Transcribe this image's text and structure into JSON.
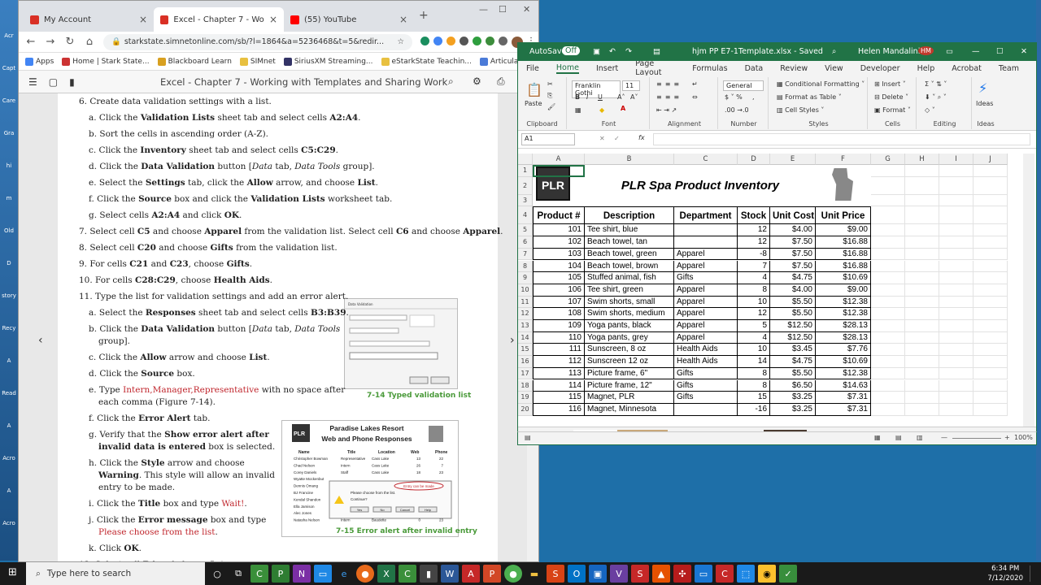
{
  "desktop": {
    "icons": [
      "Acr",
      "Capt",
      "Care",
      "Gra",
      "hi",
      "m",
      "Old",
      "D",
      "story",
      "Recy",
      "A",
      "Read",
      "A",
      "Acro",
      "A",
      "Acro"
    ]
  },
  "browser": {
    "tabs": [
      {
        "label": "My Account",
        "color": "#d93025"
      },
      {
        "label": "Excel - Chapter 7 - Working with",
        "color": "#d93025"
      },
      {
        "label": "(55) YouTube",
        "color": "#ff0000"
      }
    ],
    "url": "starkstate.simnetonline.com/sb/?l=1864&a=5236468&t=5&redir...",
    "bookmarks": [
      "Apps",
      "Home | Stark State...",
      "Blackboard Learn",
      "SIMnet",
      "SiriusXM Streaming...",
      "eStarkState Teachin...",
      "Articulate E-Learnin..."
    ],
    "reader_title": "Excel - Chapter 7 - Working with Templates and Sharing Work"
  },
  "instructions": [
    {
      "parts": [
        [
          "n",
          "6. Create data validation settings with a list."
        ]
      ]
    },
    {
      "parts": [
        [
          "n",
          "a. Click the "
        ],
        [
          "b",
          "Validation Lists"
        ],
        [
          "n",
          " sheet tab and select cells "
        ],
        [
          "b",
          "A2:A4"
        ],
        [
          "n",
          "."
        ]
      ]
    },
    {
      "parts": [
        [
          "n",
          "b. Sort the cells in ascending order (A-Z)."
        ]
      ]
    },
    {
      "parts": [
        [
          "n",
          "c. Click the "
        ],
        [
          "b",
          "Inventory"
        ],
        [
          "n",
          " sheet tab and select cells "
        ],
        [
          "b",
          "C5:C29"
        ],
        [
          "n",
          "."
        ]
      ]
    },
    {
      "parts": [
        [
          "n",
          "d. Click the "
        ],
        [
          "b",
          "Data Validation"
        ],
        [
          "n",
          " button ["
        ],
        [
          "i",
          "Data"
        ],
        [
          "n",
          " tab, "
        ],
        [
          "i",
          "Data Tools"
        ],
        [
          "n",
          " group]."
        ]
      ]
    },
    {
      "parts": [
        [
          "n",
          "e. Select the "
        ],
        [
          "b",
          "Settings"
        ],
        [
          "n",
          " tab, click the "
        ],
        [
          "b",
          "Allow"
        ],
        [
          "n",
          " arrow, and choose "
        ],
        [
          "b",
          "List"
        ],
        [
          "n",
          "."
        ]
      ]
    },
    {
      "parts": [
        [
          "n",
          "f. Click the "
        ],
        [
          "b",
          "Source"
        ],
        [
          "n",
          " box and click the "
        ],
        [
          "b",
          "Validation Lists"
        ],
        [
          "n",
          " worksheet tab."
        ]
      ]
    },
    {
      "parts": [
        [
          "n",
          "g. Select cells "
        ],
        [
          "b",
          "A2:A4"
        ],
        [
          "n",
          " and click "
        ],
        [
          "b",
          "OK"
        ],
        [
          "n",
          "."
        ]
      ]
    },
    {
      "parts": [
        [
          "n",
          "7. Select cell "
        ],
        [
          "b",
          "C5"
        ],
        [
          "n",
          " and choose "
        ],
        [
          "b",
          "Apparel"
        ],
        [
          "n",
          " from the validation list. Select cell "
        ],
        [
          "b",
          "C6"
        ],
        [
          "n",
          " and choose "
        ],
        [
          "b",
          "Apparel"
        ],
        [
          "n",
          "."
        ]
      ]
    },
    {
      "parts": [
        [
          "n",
          "8. Select cell "
        ],
        [
          "b",
          "C20"
        ],
        [
          "n",
          " and choose "
        ],
        [
          "b",
          "Gifts"
        ],
        [
          "n",
          " from the validation list."
        ]
      ]
    },
    {
      "parts": [
        [
          "n",
          "9. For cells "
        ],
        [
          "b",
          "C21"
        ],
        [
          "n",
          " and "
        ],
        [
          "b",
          "C23"
        ],
        [
          "n",
          ", choose "
        ],
        [
          "b",
          "Gifts"
        ],
        [
          "n",
          "."
        ]
      ]
    },
    {
      "parts": [
        [
          "n",
          "10. For cells "
        ],
        [
          "b",
          "C28:C29"
        ],
        [
          "n",
          ", choose "
        ],
        [
          "b",
          "Health Aids"
        ],
        [
          "n",
          "."
        ]
      ]
    },
    {
      "parts": [
        [
          "n",
          "11. Type the list for validation settings and add an error alert."
        ]
      ]
    },
    {
      "parts": [
        [
          "n",
          "a. Select the "
        ],
        [
          "b",
          "Responses"
        ],
        [
          "n",
          " sheet tab and select cells "
        ],
        [
          "b",
          "B3:B39"
        ],
        [
          "n",
          "."
        ]
      ]
    },
    {
      "parts": [
        [
          "n",
          "b. Click the "
        ],
        [
          "b",
          "Data Validation"
        ],
        [
          "n",
          " button ["
        ],
        [
          "i",
          "Data"
        ],
        [
          "n",
          " tab, "
        ],
        [
          "i",
          "Data Tools"
        ]
      ]
    },
    {
      "parts": [
        [
          "n",
          "group]."
        ]
      ]
    },
    {
      "parts": [
        [
          "n",
          "c. Click the "
        ],
        [
          "b",
          "Allow"
        ],
        [
          "n",
          " arrow and choose "
        ],
        [
          "b",
          "List"
        ],
        [
          "n",
          "."
        ]
      ]
    },
    {
      "parts": [
        [
          "n",
          "d. Click the "
        ],
        [
          "b",
          "Source"
        ],
        [
          "n",
          " box."
        ]
      ]
    },
    {
      "parts": [
        [
          "n",
          "e. Type "
        ],
        [
          "r",
          "Intern,Manager,Representative"
        ],
        [
          "n",
          " with no space after"
        ]
      ]
    },
    {
      "parts": [
        [
          "n",
          "each comma (Figure 7-14)."
        ]
      ]
    },
    {
      "parts": [
        [
          "n",
          "f. Click the "
        ],
        [
          "b",
          "Error Alert"
        ],
        [
          "n",
          " tab."
        ]
      ]
    },
    {
      "parts": [
        [
          "n",
          "g. Verify that the "
        ],
        [
          "b",
          "Show error alert after"
        ]
      ]
    },
    {
      "parts": [
        [
          "b",
          "invalid data is entered"
        ],
        [
          "n",
          " box is selected."
        ]
      ]
    },
    {
      "parts": [
        [
          "n",
          "h. Click the "
        ],
        [
          "b",
          "Style"
        ],
        [
          "n",
          " arrow and choose"
        ]
      ]
    },
    {
      "parts": [
        [
          "b",
          "Warning"
        ],
        [
          "n",
          ". This style will allow an invalid"
        ]
      ]
    },
    {
      "parts": [
        [
          "n",
          "entry to be made."
        ]
      ]
    },
    {
      "parts": [
        [
          "n",
          "i. Click the "
        ],
        [
          "b",
          "Title"
        ],
        [
          "n",
          " box and type "
        ],
        [
          "r",
          "Wait!"
        ],
        [
          "n",
          "."
        ]
      ]
    },
    {
      "parts": [
        [
          "n",
          "j. Click the "
        ],
        [
          "b",
          "Error message"
        ],
        [
          "n",
          " box and type"
        ]
      ]
    },
    {
      "parts": [
        [
          "r",
          "Please choose from the list"
        ],
        [
          "n",
          "."
        ]
      ]
    },
    {
      "parts": [
        [
          "n",
          "k. Click "
        ],
        [
          "b",
          "OK"
        ],
        [
          "n",
          "."
        ]
      ]
    },
    {
      "parts": [
        [
          "n",
          "12. Select cell "
        ],
        [
          "b",
          "B4"
        ],
        [
          "n",
          " and choose "
        ],
        [
          "b",
          "Intern"
        ],
        [
          "n",
          "."
        ]
      ]
    }
  ],
  "figures": {
    "fig14_caption": "7-14 Typed validation list",
    "fig15_caption": "7-15 Error alert after invalid entry",
    "fig15_title1": "Paradise Lakes Resort",
    "fig15_title2": "Web and Phone Responses",
    "fig15_headers": [
      "Name",
      "Title",
      "Location",
      "Web",
      "Phone"
    ],
    "fig15_names": [
      "Christopher Bowman",
      "Chad Nelson",
      "Corey Daniels",
      "Wyatte Mockenbut",
      "Dennis Omang",
      "BJ Francine",
      "Kendal Shandon",
      "Ella Jamison",
      "Alec Jones",
      "Natasha Nelson"
    ],
    "fig15_titles": [
      "Representative",
      "Intern",
      "Staff",
      "",
      "",
      "",
      "",
      "",
      "",
      "Intern"
    ],
    "fig15_locs": [
      "Cass Lake",
      "Cass Lake",
      "Cass Lake",
      "",
      "",
      "",
      "",
      "",
      "",
      "Baudette"
    ],
    "fig15_web": [
      "13",
      "26",
      "18",
      "",
      "",
      "",
      "",
      "",
      "",
      "0"
    ],
    "fig15_phone": [
      "22",
      "7",
      "23",
      "",
      "",
      "",
      "",
      "",
      "",
      "23"
    ],
    "fig15_callout": "Entry can be made",
    "fig15_msg": "Please choose from the list.",
    "fig15_cont": "Continue?",
    "fig15_btns": [
      "Yes",
      "No",
      "Cancel",
      "Help"
    ]
  },
  "excel": {
    "autosave": "AutoSave",
    "autosave_state": "Off",
    "filename": "hjm PP E7-1Template.xlsx - Saved",
    "user": "Helen Mandalinich",
    "initials": "HM",
    "menus": [
      "File",
      "Home",
      "Insert",
      "Page Layout",
      "Formulas",
      "Data",
      "Review",
      "View",
      "Developer",
      "Help",
      "Acrobat",
      "Team"
    ],
    "font_name": "Franklin Gothi",
    "font_size": "11",
    "number_format": "General",
    "ribbon": {
      "clipboard": "Clipboard",
      "font": "Font",
      "alignment": "Alignment",
      "number": "Number",
      "styles": "Styles",
      "cells": "Cells",
      "editing": "Editing",
      "ideas": "Ideas",
      "paste": "Paste",
      "cond": "Conditional Formatting",
      "fmt_table": "Format as Table",
      "cell_styles": "Cell Styles",
      "insert": "Insert",
      "delete": "Delete",
      "format": "Format",
      "ideas_btn": "Ideas"
    },
    "namebox": "A1",
    "columns": [
      "A",
      "B",
      "C",
      "D",
      "E",
      "F",
      "G",
      "H",
      "I",
      "J"
    ],
    "title": "PLR Spa Product Inventory",
    "headers": [
      "Product #",
      "Description",
      "Department",
      "Stock",
      "Unit Cost",
      "Unit Price"
    ],
    "rows": [
      [
        "101",
        "Tee shirt, blue",
        "",
        "12",
        "$4.00",
        "$9.00"
      ],
      [
        "102",
        "Beach towel, tan",
        "",
        "12",
        "$7.50",
        "$16.88"
      ],
      [
        "103",
        "Beach towel, green",
        "Apparel",
        "-8",
        "$7.50",
        "$16.88"
      ],
      [
        "104",
        "Beach towel, brown",
        "Apparel",
        "7",
        "$7.50",
        "$16.88"
      ],
      [
        "105",
        "Stuffed animal, fish",
        "Gifts",
        "4",
        "$4.75",
        "$10.69"
      ],
      [
        "106",
        "Tee shirt, green",
        "Apparel",
        "8",
        "$4.00",
        "$9.00"
      ],
      [
        "107",
        "Swim shorts, small",
        "Apparel",
        "10",
        "$5.50",
        "$12.38"
      ],
      [
        "108",
        "Swim shorts, medium",
        "Apparel",
        "12",
        "$5.50",
        "$12.38"
      ],
      [
        "109",
        "Yoga pants, black",
        "Apparel",
        "5",
        "$12.50",
        "$28.13"
      ],
      [
        "110",
        "Yoga pants, grey",
        "Apparel",
        "4",
        "$12.50",
        "$28.13"
      ],
      [
        "111",
        "Sunscreen, 8 oz",
        "Health Aids",
        "10",
        "$3.45",
        "$7.76"
      ],
      [
        "112",
        "Sunscreen 12 oz",
        "Health Aids",
        "14",
        "$4.75",
        "$10.69"
      ],
      [
        "113",
        "Picture frame, 6\"",
        "Gifts",
        "8",
        "$5.50",
        "$12.38"
      ],
      [
        "114",
        "Picture frame, 12\"",
        "Gifts",
        "8",
        "$6.50",
        "$14.63"
      ],
      [
        "115",
        "Magnet, PLR",
        "Gifts",
        "15",
        "$3.25",
        "$7.31"
      ],
      [
        "116",
        "Magnet, Minnesota",
        "",
        "-16",
        "$3.25",
        "$7.31"
      ]
    ],
    "sheet_tabs": [
      "Inventory",
      "Responses",
      "Validation Lists",
      "Guests",
      "Data E..."
    ],
    "zoom": "100%"
  },
  "taskbar": {
    "search_placeholder": "Type here to search",
    "time": "6:34 PM",
    "date": "7/12/2020"
  }
}
